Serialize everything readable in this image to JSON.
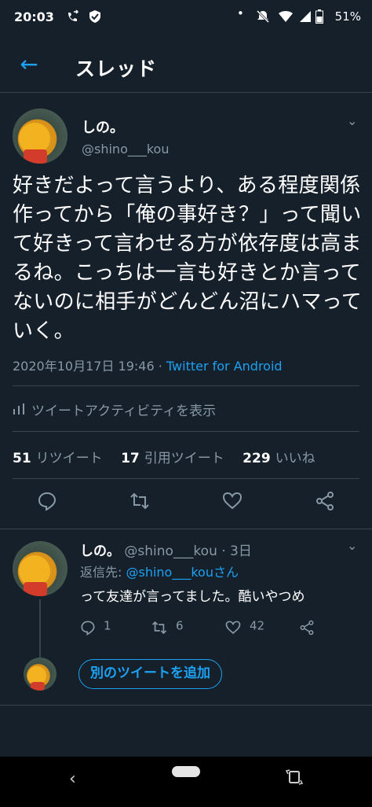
{
  "status_bar": {
    "time": "20:03",
    "battery": "51%",
    "icons": [
      "call-forward-icon",
      "shield-icon",
      "dot-icon",
      "mute-icon",
      "wifi-icon",
      "signal-icon",
      "battery-icon"
    ]
  },
  "header": {
    "title": "スレッド",
    "back_icon": "←"
  },
  "main_tweet": {
    "author_name": "しの。",
    "author_handle": "@shino___kou",
    "caret": "⌄",
    "text": "好きだよって言うより、ある程度関係作ってから「俺の事好き？」って聞いて好きって言わせる方が依存度は高まるね。こっちは一言も好きとか言ってないのに相手がどんどん沼にハマっていく。",
    "timestamp": "2020年10月17日 19:46",
    "separator": " · ",
    "source": "Twitter for Android",
    "activity_label": "ツイートアクティビティを表示",
    "stats": {
      "retweets_count": "51",
      "retweets_label": "リツイート",
      "quotes_count": "17",
      "quotes_label": "引用ツイート",
      "likes_count": "229",
      "likes_label": "いいね"
    }
  },
  "reply_tweet": {
    "author_name": "しの。",
    "handle_time": "@shino___kou · 3日",
    "caret": "⌄",
    "reply_to_label": "返信先: ",
    "reply_to_mention": "@shino___kouさん",
    "text": "って友達が言ってました。酷いやつめ",
    "reply_count": "1",
    "retweet_count": "6",
    "like_count": "42"
  },
  "compose": {
    "add_tweet_label": "別のツイートを追加"
  },
  "nav": {
    "back": "‹"
  },
  "colors": {
    "background": "#15202b",
    "accent": "#1da1f2",
    "secondary_text": "#8899a6",
    "divider": "#38444d"
  }
}
